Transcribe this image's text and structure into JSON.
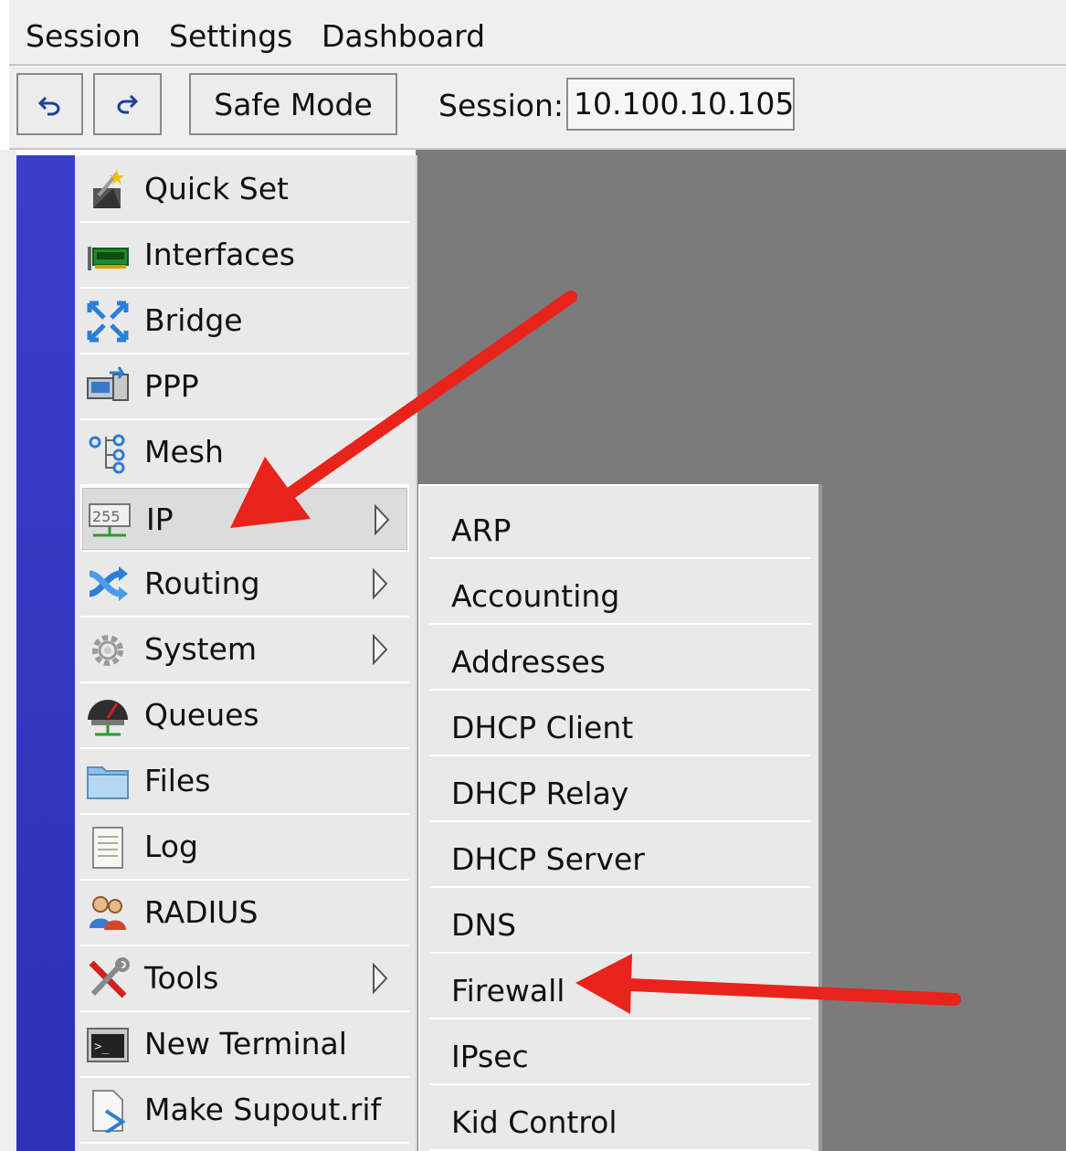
{
  "menubar": {
    "items": [
      "Session",
      "Settings",
      "Dashboard"
    ]
  },
  "toolbar": {
    "undo_icon": "undo-icon",
    "redo_icon": "redo-icon",
    "safe_mode_label": "Safe Mode",
    "session_label": "Session:",
    "session_value": "10.100.10.105"
  },
  "main_menu": {
    "items": [
      {
        "label": "Quick Set",
        "icon": "magic-wand-icon"
      },
      {
        "label": "Interfaces",
        "icon": "network-card-icon"
      },
      {
        "label": "Bridge",
        "icon": "bridge-icon"
      },
      {
        "label": "PPP",
        "icon": "ppp-icon"
      },
      {
        "label": "Mesh",
        "icon": "mesh-icon"
      },
      {
        "label": "IP",
        "icon": "ip-255-icon",
        "has_submenu": true,
        "selected": true
      },
      {
        "label": "Routing",
        "icon": "routing-icon",
        "has_submenu": true
      },
      {
        "label": "System",
        "icon": "gear-icon",
        "has_submenu": true
      },
      {
        "label": "Queues",
        "icon": "gauge-icon"
      },
      {
        "label": "Files",
        "icon": "folder-icon"
      },
      {
        "label": "Log",
        "icon": "log-document-icon"
      },
      {
        "label": "RADIUS",
        "icon": "users-icon"
      },
      {
        "label": "Tools",
        "icon": "tools-icon",
        "has_submenu": true
      },
      {
        "label": "New Terminal",
        "icon": "terminal-icon"
      },
      {
        "label": "Make Supout.rif",
        "icon": "document-arrow-icon"
      }
    ]
  },
  "ip_submenu": {
    "items": [
      "ARP",
      "Accounting",
      "Addresses",
      "DHCP Client",
      "DHCP Relay",
      "DHCP Server",
      "DNS",
      "Firewall",
      "IPsec",
      "Kid Control"
    ]
  },
  "colors": {
    "stripe": "#3a3ec9",
    "workspace": "#7b7b7b",
    "menu_bg": "#e9e9e9",
    "annotation_arrow": "#e8231b"
  }
}
